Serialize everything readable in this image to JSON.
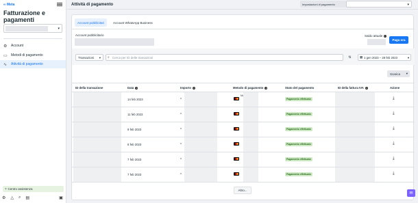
{
  "sidebar": {
    "logo": "Meta",
    "title": "Fatturazione e pagamenti",
    "nav": [
      {
        "label": "Account",
        "icon": "account-icon"
      },
      {
        "label": "Metodi di pagamento",
        "icon": "card-icon"
      },
      {
        "label": "Attività di pagamento",
        "icon": "activity-icon",
        "active": true
      }
    ],
    "help": "Centro assistenza"
  },
  "header": {
    "title": "Attività di pagamento",
    "settings_label": "Impostazioni di pagamento"
  },
  "tabs": [
    "Account pubblicitari",
    "Account WhatsApp Business"
  ],
  "account": {
    "label": "Account pubblicitario",
    "balance_label": "Saldo attuale",
    "pay_button": "Paga ora"
  },
  "toolbar": {
    "type_select": "Transazioni",
    "search_placeholder": "Cerca per ID delle transazioni",
    "date_range": "1 gen 2023 – 28 feb 2023",
    "download": "Scarica"
  },
  "table": {
    "columns": [
      "ID della transazione",
      "Data",
      "Importo",
      "Metodo di pagamento",
      "Stato del pagamento",
      "ID della fattura IVA",
      "Azione"
    ],
    "rows": [
      {
        "date": "14 feb 2023",
        "method": "MasterCard",
        "status": "Pagamento effettuato"
      },
      {
        "date": "11 feb 2023",
        "method": "",
        "status": "Pagamento effettuato"
      },
      {
        "date": "9 feb 2023",
        "method": "",
        "status": "Pagamento effettuato"
      },
      {
        "date": "8 feb 2023",
        "method": "",
        "status": "Pagamento effettuato"
      },
      {
        "date": "7 feb 2023",
        "method": "",
        "status": "Pagamento effettuato"
      },
      {
        "date": "7 feb 2023",
        "method": "",
        "status": "Pagamento effettuato"
      }
    ],
    "more_button": "Altro..."
  },
  "colors": {
    "accent": "#1877f2",
    "success_bg": "#cde9c4",
    "success_text": "#2c6b1d"
  }
}
